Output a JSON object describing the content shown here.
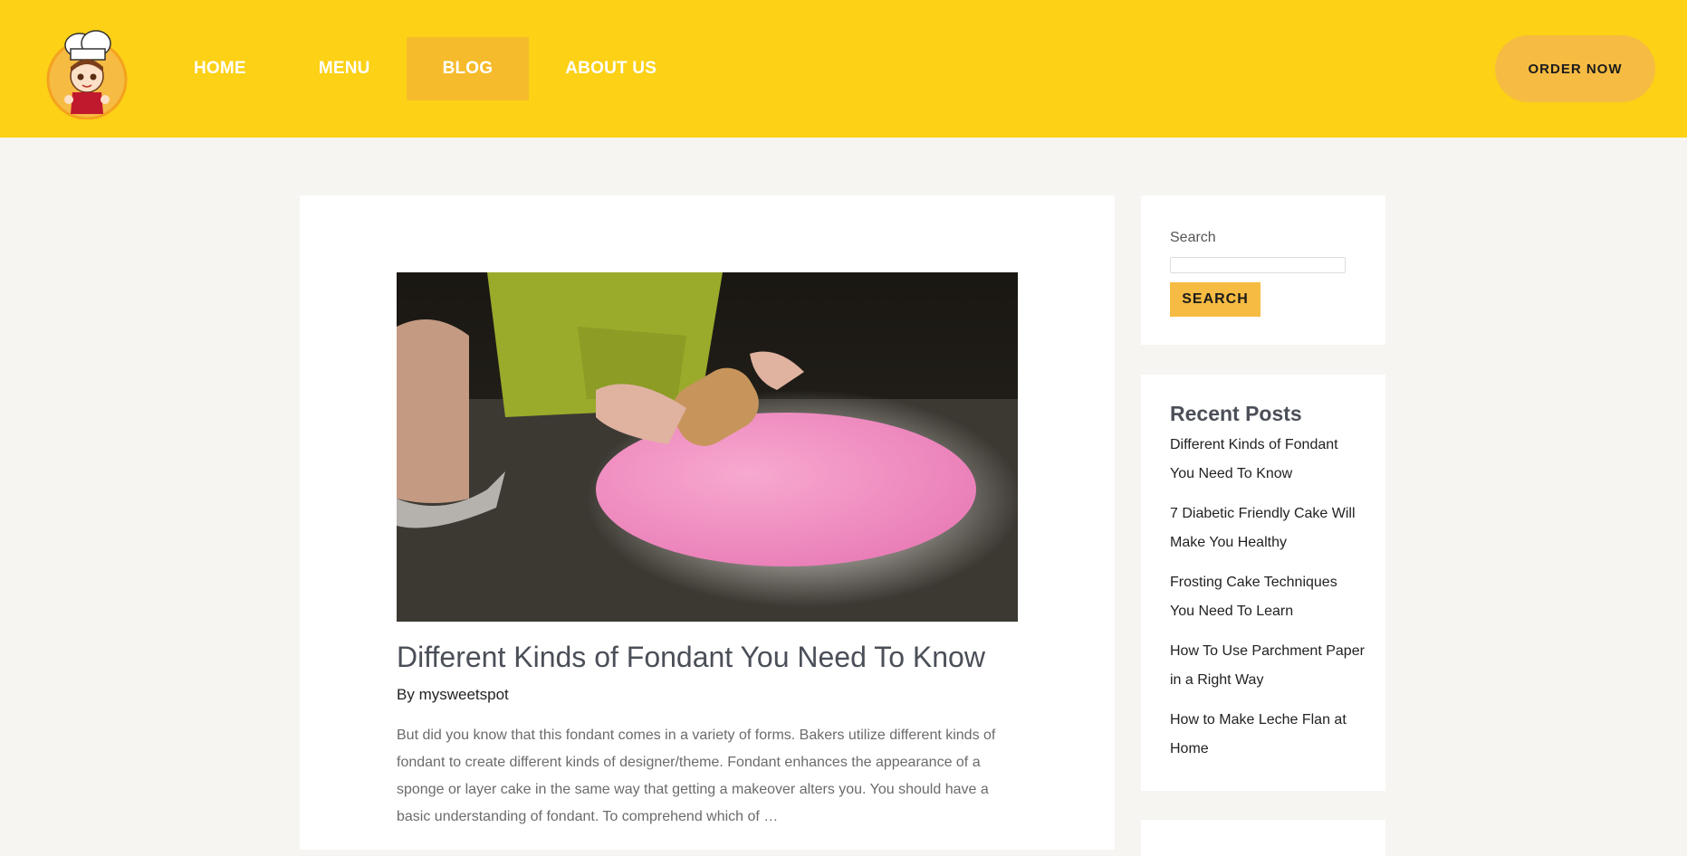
{
  "nav": {
    "items": [
      {
        "label": "HOME"
      },
      {
        "label": "MENU"
      },
      {
        "label": "BLOG"
      },
      {
        "label": "ABOUT US"
      }
    ],
    "active": "BLOG",
    "order_now": "ORDER NOW"
  },
  "post": {
    "title": "Different Kinds of Fondant You Need To Know",
    "byline_prefix": "By ",
    "author": "mysweetspot",
    "excerpt": "But did you know that this fondant comes in a variety of forms. Bakers utilize different kinds of fondant to create different kinds of designer/theme. Fondant enhances the appearance of a sponge or layer cake in the same way that getting a makeover alters you. You should have a basic understanding of fondant. To comprehend which of …"
  },
  "sidebar": {
    "search_label": "Search",
    "search_value": "",
    "search_button": "SEARCH",
    "recent_title": "Recent Posts",
    "recent_posts": [
      "Different Kinds of Fondant You Need To Know",
      "7 Diabetic Friendly Cake Will Make You Healthy",
      "Frosting Cake Techniques You Need To Learn",
      "How To Use Parchment Paper in a Right Way",
      "How to Make Leche Flan at Home"
    ]
  },
  "colors": {
    "header": "#fcd116",
    "accent": "#f6bb42",
    "active_nav": "#f6bb2c",
    "page_bg": "#f6f5f2"
  }
}
